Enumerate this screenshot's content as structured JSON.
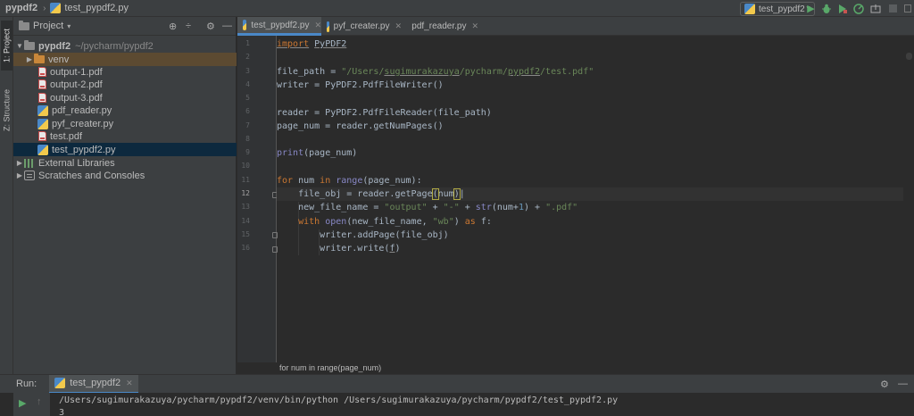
{
  "titlebar": {
    "project": "pypdf2",
    "breadcrumb_sep": "›",
    "current_file": "test_pypdf2.py",
    "run_config": "test_pypdf2"
  },
  "toolwindow_tabs": {
    "project": "1: Project",
    "structure": "Z: Structure"
  },
  "project_panel": {
    "title": "Project",
    "root": {
      "name": "pypdf2",
      "path": "~/pycharm/pypdf2"
    },
    "items": [
      {
        "name": "venv",
        "type": "folder"
      },
      {
        "name": "output-1.pdf",
        "type": "pdf"
      },
      {
        "name": "output-2.pdf",
        "type": "pdf"
      },
      {
        "name": "output-3.pdf",
        "type": "pdf"
      },
      {
        "name": "pdf_reader.py",
        "type": "py"
      },
      {
        "name": "pyf_creater.py",
        "type": "py"
      },
      {
        "name": "test.pdf",
        "type": "pdf"
      },
      {
        "name": "test_pypdf2.py",
        "type": "py",
        "selected": true
      }
    ],
    "external_libraries": "External Libraries",
    "scratches": "Scratches and Consoles"
  },
  "editor": {
    "tabs": [
      {
        "label": "test_pypdf2.py",
        "active": true
      },
      {
        "label": "pyf_creater.py",
        "active": false
      },
      {
        "label": "pdf_reader.py",
        "active": false
      }
    ],
    "line_numbers": [
      "1",
      "2",
      "3",
      "4",
      "5",
      "6",
      "7",
      "8",
      "9",
      "10",
      "11",
      "12",
      "13",
      "14",
      "15",
      "16"
    ],
    "current_line": 12,
    "hint": "for num in range(page_num)"
  },
  "run_panel": {
    "label": "Run:",
    "tab": "test_pypdf2",
    "output": [
      "/Users/sugimurakazuya/pycharm/pypdf2/venv/bin/python /Users/sugimurakazuya/pycharm/pypdf2/test_pypdf2.py",
      "3"
    ]
  },
  "colors": {
    "keyword": "#cc7832",
    "string": "#6a8759",
    "number": "#6897bb",
    "builtin": "#8888c6",
    "selection": "#0d293e",
    "run_green": "#59a869"
  },
  "icons": [
    "python-file-icon",
    "pdf-file-icon",
    "folder-icon",
    "run-icon",
    "debug-icon",
    "coverage-icon",
    "profile-icon",
    "stop-icon",
    "settings-icon",
    "minimize-icon"
  ]
}
